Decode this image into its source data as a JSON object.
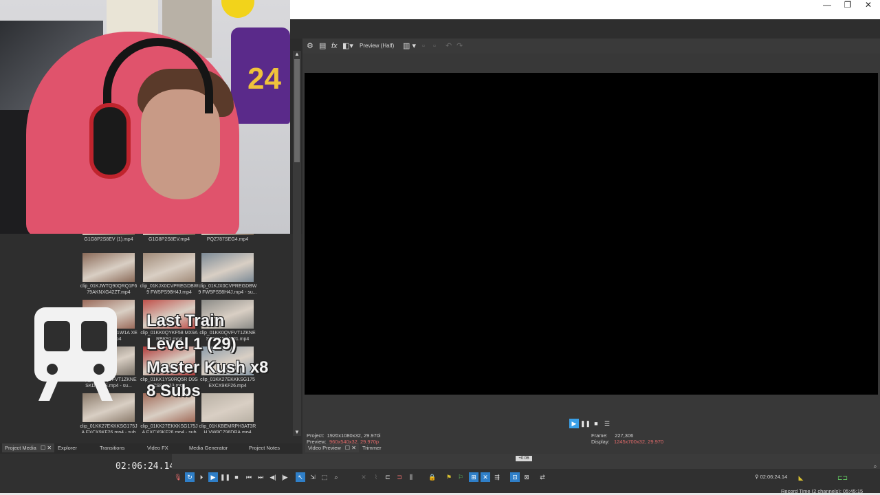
{
  "window": {
    "controls": {
      "minimize": "—",
      "restore": "❐",
      "close": "✕"
    }
  },
  "overlay": {
    "line1": "Last Train",
    "line2": "Level 1 (29)",
    "line3": "Master Kush x8",
    "line4": "8 Subs"
  },
  "media": {
    "items": [
      {
        "caption": "G1G8P2S8EV (1).mp4",
        "color": "#6a5a4a"
      },
      {
        "caption": "G1G8P2S8EV.mp4",
        "color": "#6a5a4a"
      },
      {
        "caption": "PQZ787SEG4.mp4",
        "color": "#6a5a4a"
      },
      {
        "caption": "clip_01KJWTQ90QRQ1F6 79AKNXG42ZT.mp4",
        "color": "#8a6a58"
      },
      {
        "caption": "clip_01KJX0CVPREGDBW9 FW5PS98H4J.mp4",
        "color": "#a08a78"
      },
      {
        "caption": "clip_01KJX0CVPREGDBW9 FW5PS98H4J.mp4 - su...",
        "color": "#7c8a96"
      },
      {
        "caption": "clip_01KK0P9XC1W1A XEKSX8T.mp4",
        "color": "#9a6a5a"
      },
      {
        "caption": "clip_01KK0QYKF58 MX9ARBK91.mp4",
        "color": "#c0504a"
      },
      {
        "caption": "clip_01KK0QVFVT1ZKNE SKDX1DEEM1.mp4",
        "color": "#8a8a86"
      },
      {
        "caption": "clip_01KK0QVFVT1ZKNE SKDX1DE.mp4 - su...",
        "color": "#7a7268"
      },
      {
        "caption": "clip_01KK1YS0RQ5R D9SZS81QB3.mp4",
        "color": "#b03a3a"
      },
      {
        "caption": "clip_01KK27EKKKSG175 EXCX9KF26.mp4",
        "color": "#8a9aa8"
      },
      {
        "caption": "clip_01KK27EKKKSG175JA EXCX9KF26.mp4 - subd...",
        "color": "#8a7a6a"
      },
      {
        "caption": "clip_01KK27EKKKSG175JA EXCX9KF26.mp4 - subd...",
        "color": "#a06a58"
      },
      {
        "caption": "clip_01KKBEMRPH3AT3RH VW8C796DRA.mp4",
        "color": "#b8b0a4"
      }
    ]
  },
  "preview": {
    "toolbar": {
      "settings_icon": "⚙",
      "mode_label": "Preview (Half)"
    },
    "info": {
      "project_label": "Project:",
      "project_value": "1920x1080x32, 29.970i",
      "preview_label": "Preview:",
      "preview_value": "960x540x32, 29.970p",
      "frame_label": "Frame:",
      "frame_value": "227,306",
      "display_label": "Display:",
      "display_value": "1245x700x32, 29.970"
    }
  },
  "tabs": {
    "left": [
      "Project Media",
      "Explorer",
      "Transitions",
      "Video FX",
      "Media Generator",
      "Project Notes"
    ],
    "right": [
      "Video Preview",
      "Trimmer"
    ]
  },
  "timeline": {
    "time": "02:06:24.14",
    "cursor_flag": "+0:06",
    "time_small": "02:06:24.14",
    "record_time": "Record Time (2 channels): 05:45:15"
  }
}
